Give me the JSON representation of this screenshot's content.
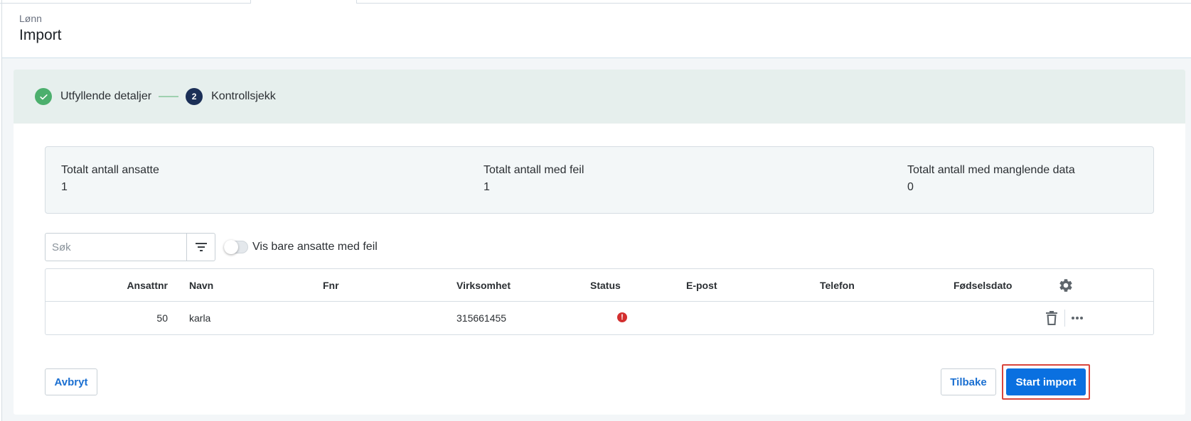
{
  "header": {
    "breadcrumb": "Lønn",
    "title": "Import"
  },
  "stepper": {
    "steps": [
      {
        "number": "",
        "label": "Utfyllende detaljer",
        "state": "done"
      },
      {
        "number": "2",
        "label": "Kontrollsjekk",
        "state": "active"
      }
    ]
  },
  "summary": {
    "total_employees_label": "Totalt antall ansatte",
    "total_employees_value": "1",
    "total_errors_label": "Totalt antall med feil",
    "total_errors_value": "1",
    "total_missing_label": "Totalt antall med manglende data",
    "total_missing_value": "0"
  },
  "search": {
    "placeholder": "Søk",
    "value": ""
  },
  "toggle": {
    "label": "Vis bare ansatte med feil",
    "checked": false
  },
  "table": {
    "columns": [
      "Ansattnr",
      "Navn",
      "Fnr",
      "Virksomhet",
      "Status",
      "E-post",
      "Telefon",
      "Fødselsdato"
    ],
    "rows": [
      {
        "ansattnr": "50",
        "navn": "karla",
        "fnr": "",
        "virksomhet": "315661455",
        "status": "error",
        "epost": "",
        "telefon": "",
        "fodselsdato": ""
      }
    ]
  },
  "footer": {
    "cancel_label": "Avbryt",
    "back_label": "Tilbake",
    "start_label": "Start import"
  },
  "colors": {
    "primary": "#0a70e0",
    "step_done": "#4caf6d",
    "step_active": "#1b2f57",
    "error": "#d32f2f",
    "highlight": "#d9453b"
  }
}
